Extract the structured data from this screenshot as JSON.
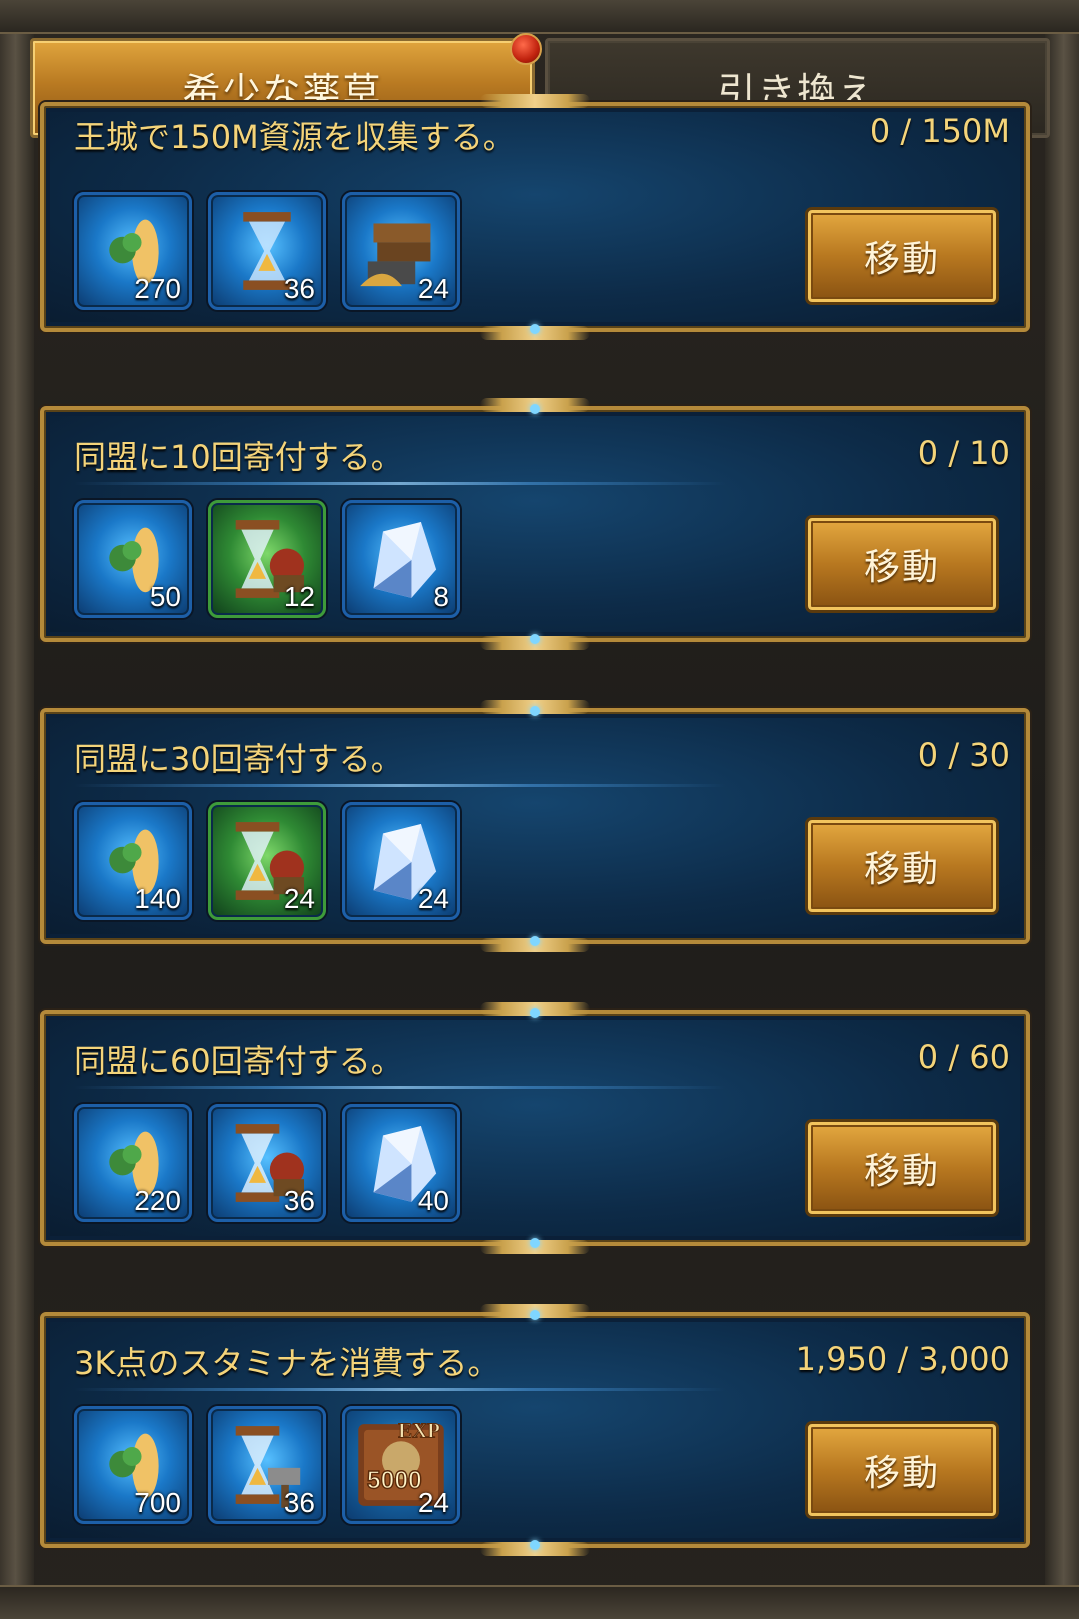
{
  "tabs": [
    {
      "label": "希少な薬草",
      "active": true
    },
    {
      "label": "引き換え",
      "active": false
    }
  ],
  "move_label": "移動",
  "tasks": [
    {
      "title": "王城で150M資源を収集する。",
      "progress": "0 / 150M",
      "rewards": [
        {
          "icon": "ginseng-icon",
          "count": "270"
        },
        {
          "icon": "hourglass-icon",
          "count": "36"
        },
        {
          "icon": "resource-crate-icon",
          "count": "24"
        }
      ]
    },
    {
      "title": "同盟に10回寄付する。",
      "progress": "0 / 10",
      "rewards": [
        {
          "icon": "ginseng-icon",
          "count": "50"
        },
        {
          "icon": "training-speedup-icon",
          "count": "12"
        },
        {
          "icon": "crystal-icon",
          "count": "8"
        }
      ]
    },
    {
      "title": "同盟に30回寄付する。",
      "progress": "0 / 30",
      "rewards": [
        {
          "icon": "ginseng-icon",
          "count": "140"
        },
        {
          "icon": "training-speedup-icon",
          "count": "24"
        },
        {
          "icon": "crystal-icon",
          "count": "24"
        }
      ]
    },
    {
      "title": "同盟に60回寄付する。",
      "progress": "0 / 60",
      "rewards": [
        {
          "icon": "ginseng-icon",
          "count": "220"
        },
        {
          "icon": "training-speedup-icon",
          "count": "36"
        },
        {
          "icon": "crystal-icon",
          "count": "40"
        }
      ]
    },
    {
      "title": "3K点のスタミナを消費する。",
      "progress": "1,950 / 3,000",
      "rewards": [
        {
          "icon": "ginseng-icon",
          "count": "700"
        },
        {
          "icon": "build-speedup-icon",
          "count": "36"
        },
        {
          "icon": "exp-book-icon",
          "count": "24",
          "book_label": "EXP",
          "book_value": "5000"
        }
      ]
    }
  ]
}
